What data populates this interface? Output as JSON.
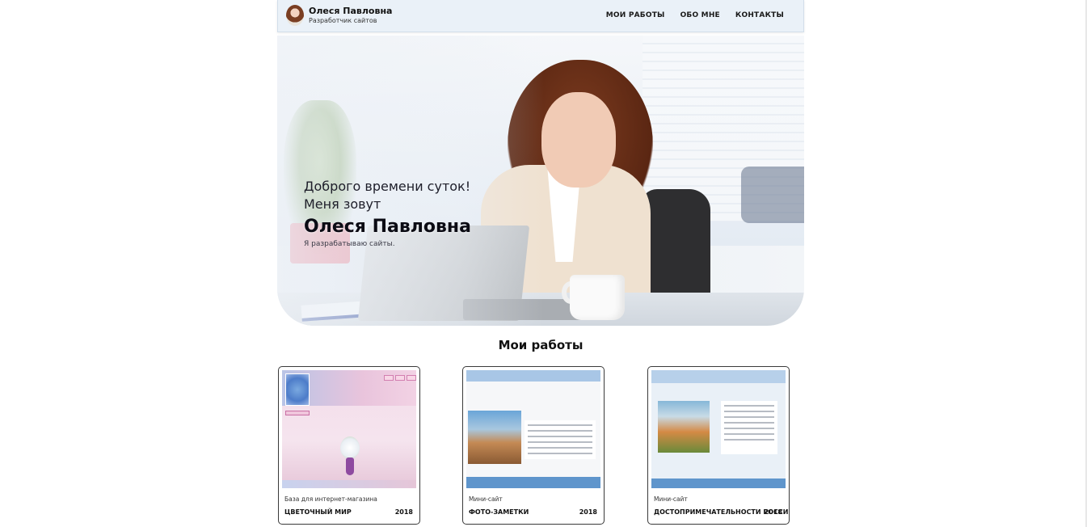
{
  "header": {
    "name": "Олеся Павловна",
    "subtitle": "Разработчик сайтов",
    "nav": [
      {
        "label": "МОИ РАБОТЫ"
      },
      {
        "label": "ОБО МНЕ"
      },
      {
        "label": "КОНТАКТЫ"
      }
    ]
  },
  "hero": {
    "greeting": "Доброго времени суток!",
    "intro": "Меня зовут",
    "name": "Олеся Павловна",
    "tagline": "Я разрабатываю сайты."
  },
  "works": {
    "title": "Мои работы",
    "cards": [
      {
        "type": "База для интернет-магазина",
        "title": "ЦВЕТОЧНЫЙ МИР",
        "year": "2018"
      },
      {
        "type": "Мини-сайт",
        "title": "ФОТО-ЗАМЕТКИ",
        "year": "2018"
      },
      {
        "type": "Мини-сайт",
        "title": "ДОСТОПРИМЕЧАТЕЛЬНОСТИ РОССИИ",
        "year": "2018"
      }
    ]
  },
  "colors": {
    "header_bg": "#eaf1f8",
    "accent_blue": "#5f95cc"
  }
}
